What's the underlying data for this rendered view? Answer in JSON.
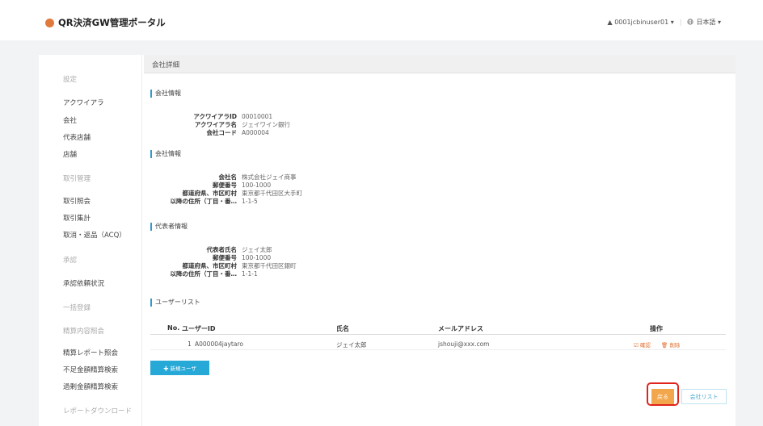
{
  "header": {
    "brand_title": "QR決済GW管理ポータル",
    "user": "▲ 0001jcbinuser01 ▾",
    "language": "日本語 ▾"
  },
  "sidebar": {
    "items": [
      {
        "label": "設定",
        "type": "head"
      },
      {
        "label": "アクワイアラ",
        "type": "link"
      },
      {
        "label": "会社",
        "type": "link"
      },
      {
        "label": "代表店舗",
        "type": "link"
      },
      {
        "label": "店舗",
        "type": "link"
      },
      {
        "label": "取引管理",
        "type": "head"
      },
      {
        "label": "取引照会",
        "type": "link"
      },
      {
        "label": "取引集計",
        "type": "link"
      },
      {
        "label": "取消・返品（ACQ）",
        "type": "link"
      },
      {
        "label": "承認",
        "type": "head"
      },
      {
        "label": "承認依頼状況",
        "type": "link"
      },
      {
        "label": "一括登録",
        "type": "head"
      },
      {
        "label": "精算内容照会",
        "type": "head"
      },
      {
        "label": "精算レポート照会",
        "type": "link"
      },
      {
        "label": "不足金額精算検索",
        "type": "link"
      },
      {
        "label": "過剰金額精算検索",
        "type": "link"
      },
      {
        "label": "レポートダウンロード",
        "type": "head"
      }
    ]
  },
  "page": {
    "title": "会社詳細",
    "sections": [
      {
        "heading": "会社情報",
        "fields": [
          {
            "key": "アクワイアラID",
            "value": "00010001"
          },
          {
            "key": "アクワイアラ名",
            "value": "ジェイワイン銀行"
          },
          {
            "key": "会社コード",
            "value": "A000004"
          }
        ]
      },
      {
        "heading": "会社情報",
        "fields": [
          {
            "key": "会社名",
            "value": "株式会社ジェイ商事"
          },
          {
            "key": "郵便番号",
            "value": "100-1000"
          },
          {
            "key": "都道府県、市区町村",
            "value": "東京都千代田区大手町"
          },
          {
            "key": "以降の住所（丁目・番…",
            "value": "1-1-5"
          }
        ]
      },
      {
        "heading": "代表者情報",
        "fields": [
          {
            "key": "代表者氏名",
            "value": "ジェイ太郎"
          },
          {
            "key": "郵便番号",
            "value": "100-1000"
          },
          {
            "key": "都道府県、市区町村",
            "value": "東京都千代田区銀町"
          },
          {
            "key": "以降の住所（丁目・番…",
            "value": "1-1-1"
          }
        ]
      }
    ],
    "user_list": {
      "heading": "ユーザーリスト",
      "columns": [
        "No.",
        "ユーザーID",
        "氏名",
        "メールアドレス",
        "操作"
      ],
      "rows": [
        {
          "no": "1",
          "user_id": "A000004jaytaro",
          "name": "ジェイ太郎",
          "email": "jshouji@xxx.com",
          "edit": "☑ 確認",
          "delete": "🗑 削除"
        }
      ],
      "add_button": "✚ 新規ユーザ"
    },
    "footer": {
      "back_button": "戻る",
      "company_list_button": "会社リスト"
    }
  },
  "colors": {
    "accent_blue": "#27a9d8",
    "back_orange": "#f2a74c",
    "highlight_red": "#e0241b"
  }
}
